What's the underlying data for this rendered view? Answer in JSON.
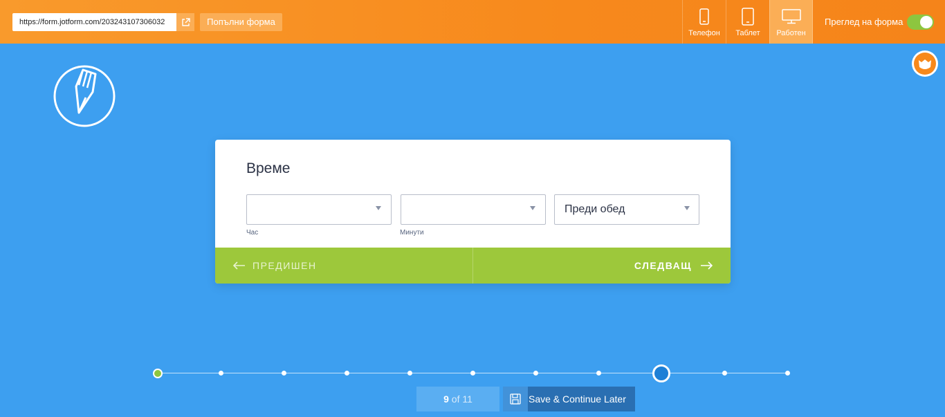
{
  "topbar": {
    "url": "https://form.jotform.com/203243107306032",
    "fill_form_label": "Попълни форма",
    "devices": [
      {
        "label": "Телефон",
        "icon": "phone-icon",
        "active": false
      },
      {
        "label": "Таблет",
        "icon": "tablet-icon",
        "active": false
      },
      {
        "label": "Работен",
        "icon": "desktop-icon",
        "active": true
      }
    ],
    "preview_label": "Преглед на форма",
    "preview_toggle_on": true
  },
  "question": {
    "title": "Време",
    "hour": {
      "value": "",
      "sublabel": "Час"
    },
    "minutes": {
      "value": "",
      "sublabel": "Минути"
    },
    "ampm": {
      "value": "Преди обед"
    }
  },
  "navigation": {
    "prev_label": "ПРЕДИШЕН",
    "next_label": "СЛЕДВАЩ"
  },
  "progress": {
    "current": 9,
    "total": 11,
    "current_text": "9",
    "of_text": "of 11"
  },
  "save_label": "Save & Continue Later",
  "colors": {
    "topbar": "#f7891c",
    "background": "#3d9ff0",
    "nav_bar": "#9dc83b",
    "save_button": "#2a6fb2"
  }
}
